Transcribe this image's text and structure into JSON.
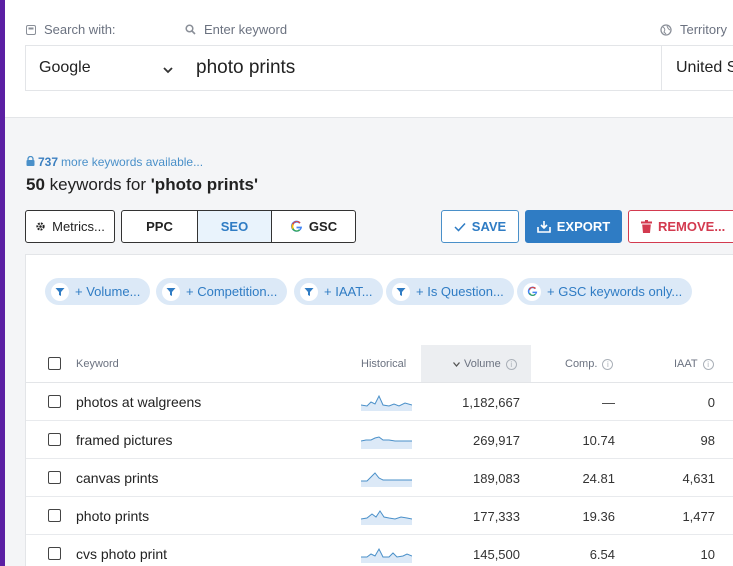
{
  "search": {
    "search_with_label": "Search with:",
    "engine_value": "Google",
    "keyword_label": "Enter keyword",
    "keyword_value": "photo prints",
    "territory_label": "Territory",
    "territory_value": "United S"
  },
  "summary": {
    "available_count": "737",
    "available_text": "more keywords available...",
    "count": "50",
    "keywords_for": "keywords for",
    "query": "'photo prints'"
  },
  "toolbar": {
    "metrics_label": "Metrics...",
    "ppc_label": "PPC",
    "seo_label": "SEO",
    "gsc_label": "GSC",
    "save_label": "SAVE",
    "export_label": "EXPORT",
    "remove_label": "REMOVE..."
  },
  "filters": [
    {
      "label": "+ Volume..."
    },
    {
      "label": "+ Competition..."
    },
    {
      "label": "+ IAAT..."
    },
    {
      "label": "+ Is Question..."
    },
    {
      "label": "+ GSC keywords only..."
    }
  ],
  "table": {
    "headers": {
      "keyword": "Keyword",
      "historical": "Historical",
      "volume": "Volume",
      "comp": "Comp.",
      "iaat": "IAAT"
    },
    "rows": [
      {
        "keyword": "photos at walgreens",
        "volume": "1,182,667",
        "comp": "—",
        "iaat": "0"
      },
      {
        "keyword": "framed pictures",
        "volume": "269,917",
        "comp": "10.74",
        "iaat": "98"
      },
      {
        "keyword": "canvas prints",
        "volume": "189,083",
        "comp": "24.81",
        "iaat": "4,631"
      },
      {
        "keyword": "photo prints",
        "volume": "177,333",
        "comp": "19.36",
        "iaat": "1,477"
      },
      {
        "keyword": "cvs photo print",
        "volume": "145,500",
        "comp": "6.54",
        "iaat": "10"
      }
    ]
  },
  "colors": {
    "accent": "#2f7cc4",
    "danger": "#d33a4f",
    "chip_bg": "#dce9f7",
    "sidebar": "#5b1fa3"
  }
}
